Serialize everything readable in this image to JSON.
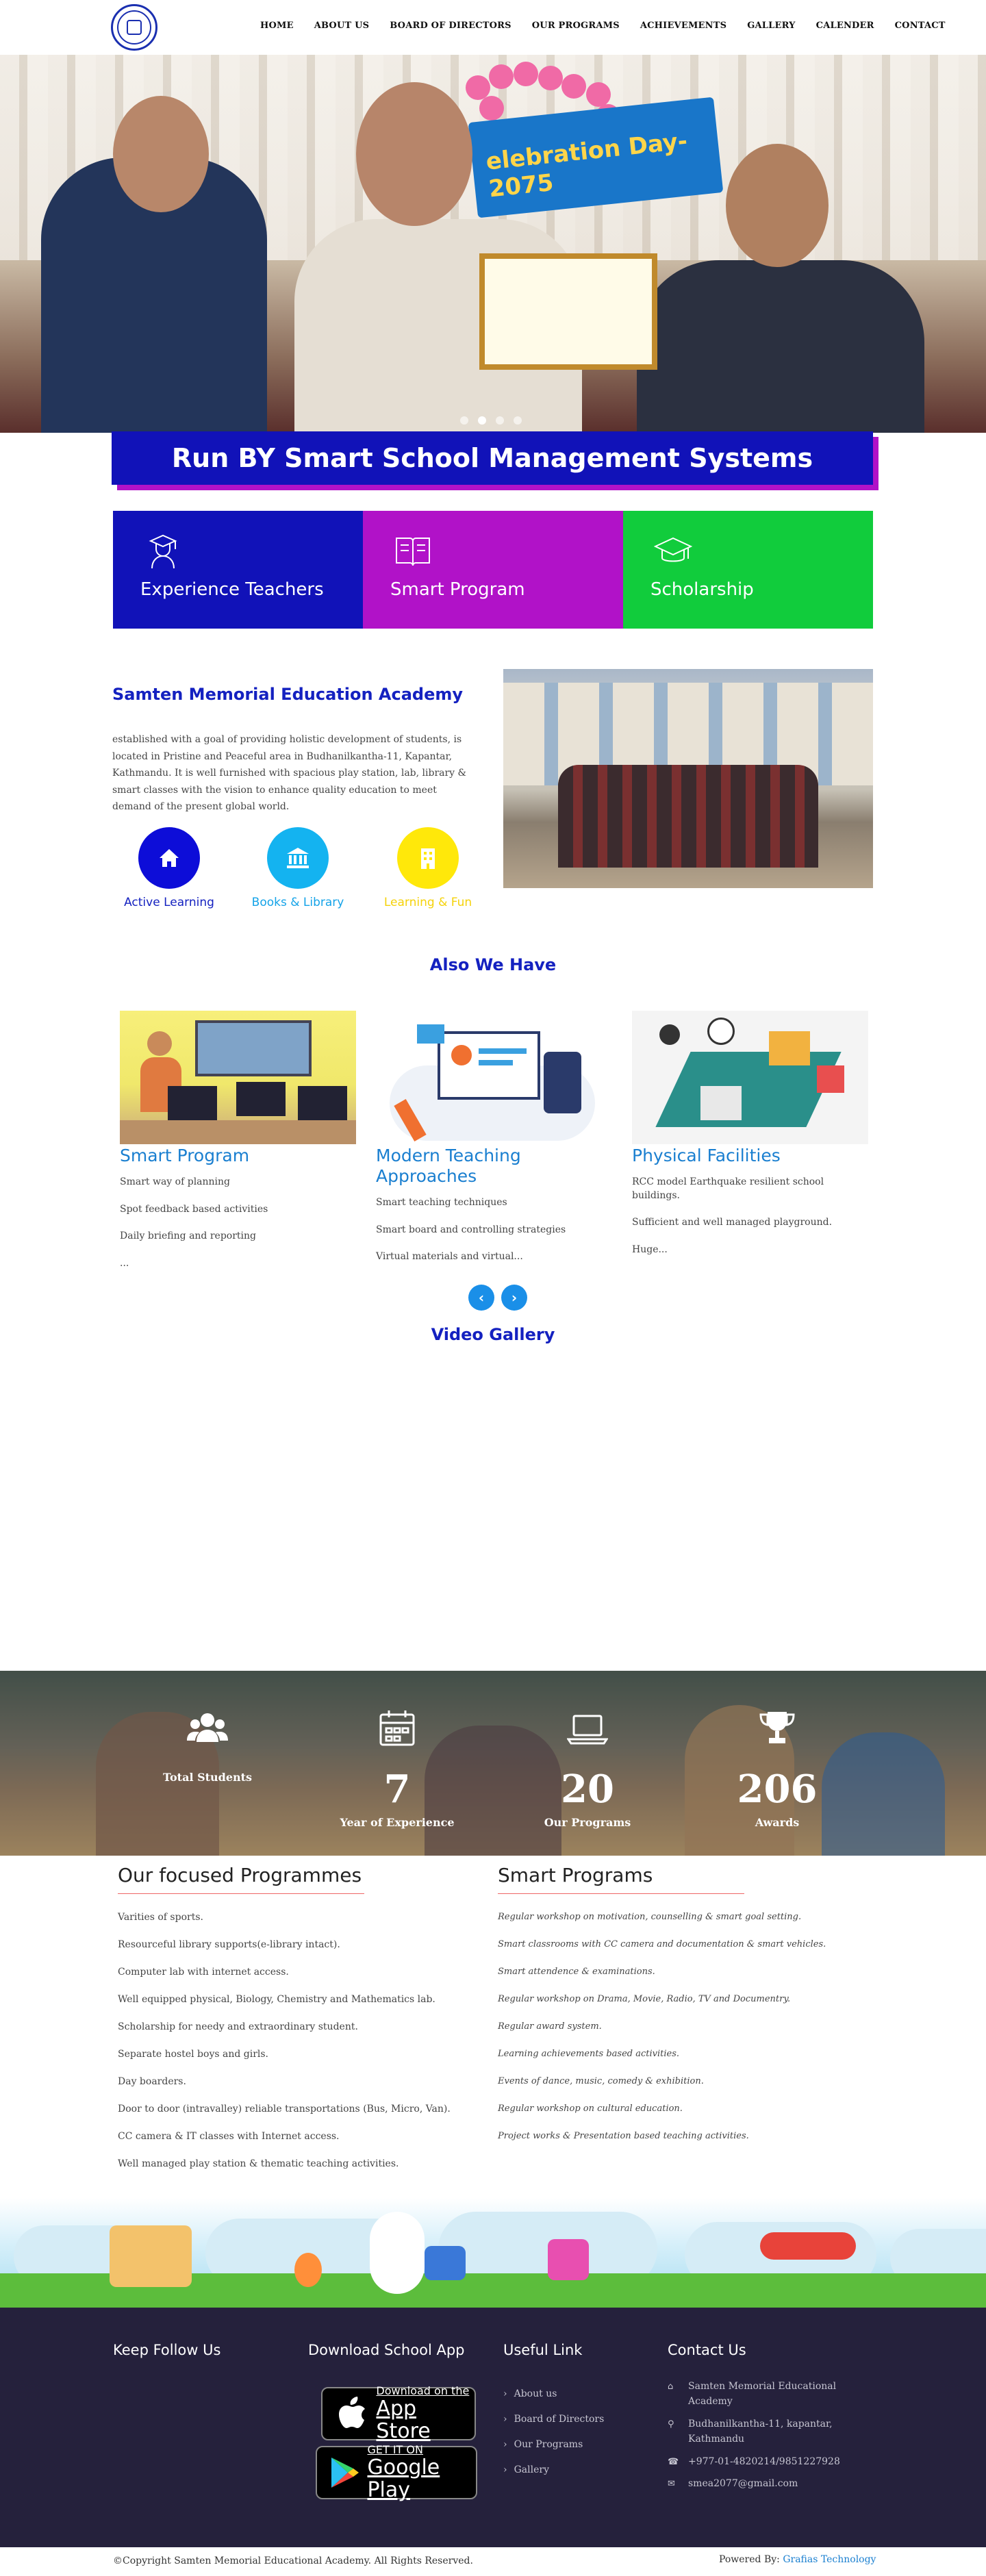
{
  "nav": {
    "items": [
      "HOME",
      "ABOUT US",
      "BOARD OF DIRECTORS",
      "OUR PROGRAMS",
      "ACHIEVEMENTS",
      "GALLERY",
      "CALENDER",
      "CONTACT"
    ]
  },
  "hero": {
    "banner_text": "elebration Day-2075",
    "slide_count": 4,
    "active_slide": 1
  },
  "runby": {
    "title": "Run BY Smart School Management Systems"
  },
  "features": [
    {
      "label": "Experience Teachers",
      "icon": "teacher-icon",
      "color": "#1112b8"
    },
    {
      "label": "Smart Program",
      "icon": "book-icon",
      "color": "#b112c8"
    },
    {
      "label": "Scholarship",
      "icon": "graduation-cap-icon",
      "color": "#11cc3c"
    }
  ],
  "about": {
    "title": "Samten Memorial Education Academy",
    "text": "established with a goal of providing holistic development of students, is located in Pristine and Peaceful area in Budhanilkantha-11, Kapantar, Kathmandu. It is well furnished with spacious play station, lab, library & smart classes with the vision to enhance quality education to meet demand of the present global world.",
    "circles": [
      {
        "label": "Active Learning",
        "icon": "home-icon",
        "color": "#0d0dd8"
      },
      {
        "label": "Books & Library",
        "icon": "institution-icon",
        "color": "#14b3f0"
      },
      {
        "label": "Learning & Fun",
        "icon": "building-icon",
        "color": "#ffe80a"
      }
    ]
  },
  "also": {
    "title": "Also We Have",
    "cards": [
      {
        "title": "Smart Program",
        "items": [
          "Smart way of planning",
          "Spot feedback based activities",
          "Daily briefing and reporting",
          "..."
        ]
      },
      {
        "title": "Modern Teaching Approaches",
        "items": [
          "Smart teaching techniques",
          "Smart board and controlling strategies",
          "Virtual materials and virtual..."
        ]
      },
      {
        "title": "Physical Facilities",
        "items": [
          "RCC model Earthquake resilient school buildings.",
          "Sufficient and well managed playground.",
          "Huge..."
        ]
      }
    ]
  },
  "video": {
    "title": "Video Gallery"
  },
  "stats": [
    {
      "number": "",
      "label": "Total Students",
      "icon": "users-icon"
    },
    {
      "number": "7",
      "label": "Year of Experience",
      "icon": "calendar-icon"
    },
    {
      "number": "20",
      "label": "Our Programs",
      "icon": "laptop-icon"
    },
    {
      "number": "206",
      "label": "Awards",
      "icon": "trophy-icon"
    }
  ],
  "programmes": {
    "focused": {
      "title": "Our focused Programmes",
      "items": [
        "Varities of sports.",
        "Resourceful library supports(e-library intact).",
        "Computer lab with internet access.",
        "Well equipped physical, Biology, Chemistry and Mathematics lab.",
        "Scholarship for needy and extraordinary student.",
        "Separate hostel boys and girls.",
        "Day boarders.",
        "Door to door (intravalley) reliable transportations (Bus, Micro, Van).",
        "CC camera & IT classes with Internet access.",
        "Well managed play station & thematic teaching activities."
      ]
    },
    "smart": {
      "title": "Smart Programs",
      "items": [
        "Regular workshop on motivation, counselling & smart goal setting.",
        "Smart classrooms with CC camera and documentation & smart vehicles.",
        "Smart attendence & examinations.",
        "Regular workshop on Drama, Movie, Radio, TV and Documentry.",
        "Regular award system.",
        "Learning achievements based activities.",
        "Events of dance, music, comedy & exhibition.",
        "Regular workshop on cultural education.",
        "Project works & Presentation based teaching activities."
      ]
    }
  },
  "footer": {
    "follow_title": "Keep Follow Us",
    "app_title": "Download School App",
    "appstore": {
      "small": "Download on the",
      "big": "App Store"
    },
    "playstore": {
      "small": "GET IT ON",
      "big": "Google Play"
    },
    "links_title": "Useful Link",
    "links": [
      "About us",
      "Board of Directors",
      "Our Programs",
      "Gallery"
    ],
    "contact_title": "Contact Us",
    "contact": [
      {
        "icon": "home-icon",
        "text": "Samten Memorial Educational Academy"
      },
      {
        "icon": "map-marker-icon",
        "text": "Budhanilkantha-11, kapantar, Kathmandu"
      },
      {
        "icon": "phone-icon",
        "text": "+977-01-4820214/9851227928"
      },
      {
        "icon": "envelope-icon",
        "text": "smea2077@gmail.com"
      }
    ],
    "copyright": "©Copyright Samten Memorial Educational Academy. All Rights Reserved.",
    "powered_prefix": "Powered By: ",
    "powered_link": "Grafias Technology"
  }
}
